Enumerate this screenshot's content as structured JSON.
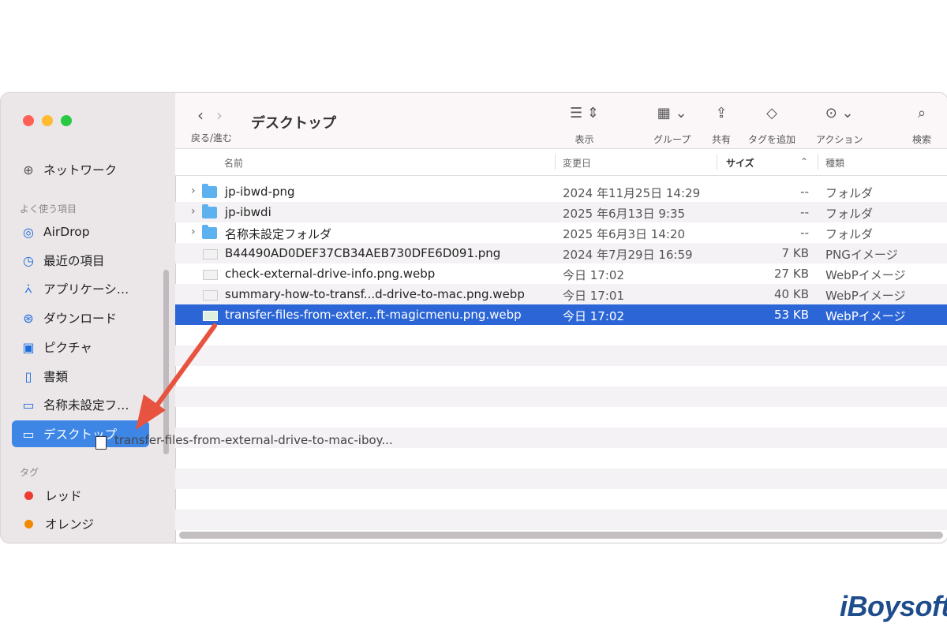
{
  "window": {
    "title": "デスクトップ"
  },
  "toolbar": {
    "nav_label": "戻る/進む",
    "view_label": "表示",
    "group_label": "グループ",
    "share_label": "共有",
    "tag_label": "タグを追加",
    "action_label": "アクション",
    "search_label": "検索"
  },
  "sidebar": {
    "network": "ネットワーク",
    "favorites_header": "よく使う項目",
    "items": [
      {
        "label": "AirDrop",
        "icon": "airdrop-icon"
      },
      {
        "label": "最近の項目",
        "icon": "clock-icon"
      },
      {
        "label": "アプリケーシ…",
        "icon": "applications-icon"
      },
      {
        "label": "ダウンロード",
        "icon": "download-icon"
      },
      {
        "label": "ピクチャ",
        "icon": "pictures-icon"
      },
      {
        "label": "書類",
        "icon": "document-icon"
      },
      {
        "label": "名称未設定フ…",
        "icon": "folder-icon"
      },
      {
        "label": "デスクトップ",
        "icon": "desktop-icon",
        "selected": true
      }
    ],
    "tags_header": "タグ",
    "tags": [
      {
        "label": "レッド",
        "color": "#ee3b30"
      },
      {
        "label": "オレンジ",
        "color": "#f08a00"
      }
    ]
  },
  "columns": {
    "name": "名前",
    "date": "変更日",
    "size": "サイズ",
    "kind": "種類"
  },
  "files": [
    {
      "name": "jp-ibwd-png",
      "date": "2024 年11月25日 14:29",
      "size": "--",
      "kind": "フォルダ",
      "type": "folder"
    },
    {
      "name": "jp-ibwdi",
      "date": "2025 年6月13日 9:35",
      "size": "--",
      "kind": "フォルダ",
      "type": "folder"
    },
    {
      "name": "名称未設定フォルダ",
      "date": "2025 年6月3日 14:20",
      "size": "--",
      "kind": "フォルダ",
      "type": "folder"
    },
    {
      "name": "B44490AD0DEF37CB34AEB730DFE6D091.png",
      "date": "2024 年7月29日 16:59",
      "size": "7 KB",
      "kind": "PNGイメージ",
      "type": "file"
    },
    {
      "name": "check-external-drive-info.png.webp",
      "date": "今日 17:02",
      "size": "27 KB",
      "kind": "WebPイメージ",
      "type": "file"
    },
    {
      "name": "summary-how-to-transf...d-drive-to-mac.png.webp",
      "date": "今日 17:01",
      "size": "40 KB",
      "kind": "WebPイメージ",
      "type": "file"
    },
    {
      "name": "transfer-files-from-exter...ft-magicmenu.png.webp",
      "date": "今日 17:02",
      "size": "53 KB",
      "kind": "WebPイメージ",
      "type": "file",
      "selected": true
    }
  ],
  "drag": {
    "label": "transfer-files-from-external-drive-to-mac-iboy..."
  },
  "brand": "iBoysoft",
  "colors": {
    "selection": "#2c66d6",
    "sidebar_selection": "#3d86e6",
    "arrow": "#e8533f"
  }
}
